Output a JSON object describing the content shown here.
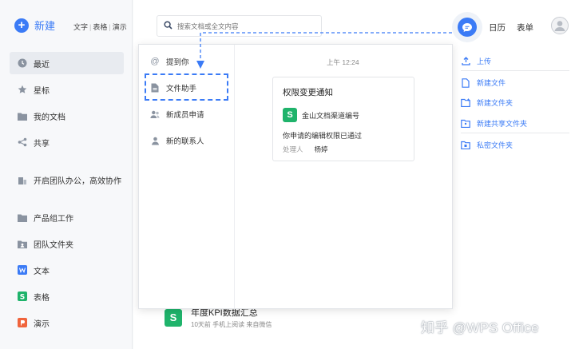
{
  "sidebar": {
    "new_label": "新建",
    "quick_links": [
      "文字",
      "表格",
      "演示"
    ],
    "items": [
      {
        "label": "最近",
        "icon": "clock-icon",
        "active": true
      },
      {
        "label": "星标",
        "icon": "star-icon"
      },
      {
        "label": "我的文档",
        "icon": "folder-icon"
      },
      {
        "label": "共享",
        "icon": "share-icon"
      },
      {
        "label": "开启团队办公，高效协作",
        "icon": "team-building-icon"
      },
      {
        "label": "产品组工作",
        "icon": "folder-icon"
      },
      {
        "label": "团队文件夹",
        "icon": "team-folder-icon"
      },
      {
        "label": "文本",
        "icon": "writer-icon"
      },
      {
        "label": "表格",
        "icon": "spreadsheet-icon"
      },
      {
        "label": "演示",
        "icon": "presentation-icon"
      }
    ]
  },
  "header": {
    "search_placeholder": "搜索文档或全文内容",
    "calendar_label": "日历",
    "form_label": "表单"
  },
  "actions": {
    "upload": "上传",
    "new_file": "新建文件",
    "new_folder": "新建文件夹",
    "new_shared_folder": "新建共享文件夹",
    "private_folder": "私密文件夹"
  },
  "popup": {
    "items": [
      {
        "label": "提到你",
        "icon": "at-icon"
      },
      {
        "label": "文件助手",
        "icon": "file-assistant-icon"
      },
      {
        "label": "新成员申请",
        "icon": "member-request-icon"
      },
      {
        "label": "新的联系人",
        "icon": "contact-icon"
      }
    ],
    "time": "上午 12:24",
    "card": {
      "title": "权限变更通知",
      "source": "金山文档渠道编号",
      "source_icon_letter": "S",
      "message": "你申请的编辑权限已通过",
      "handler_label": "处理人",
      "handler_value": "杨婷"
    }
  },
  "recent_doc": {
    "title": "年度KPI数据汇总",
    "meta": "10天前  手机上阅读  来自微信",
    "icon_letter": "S"
  },
  "watermark": "知乎 @WPS Office",
  "colors": {
    "accent": "#3b7bf6",
    "spreadsheet_green": "#1fb36b",
    "presentation_red": "#f0643c"
  }
}
